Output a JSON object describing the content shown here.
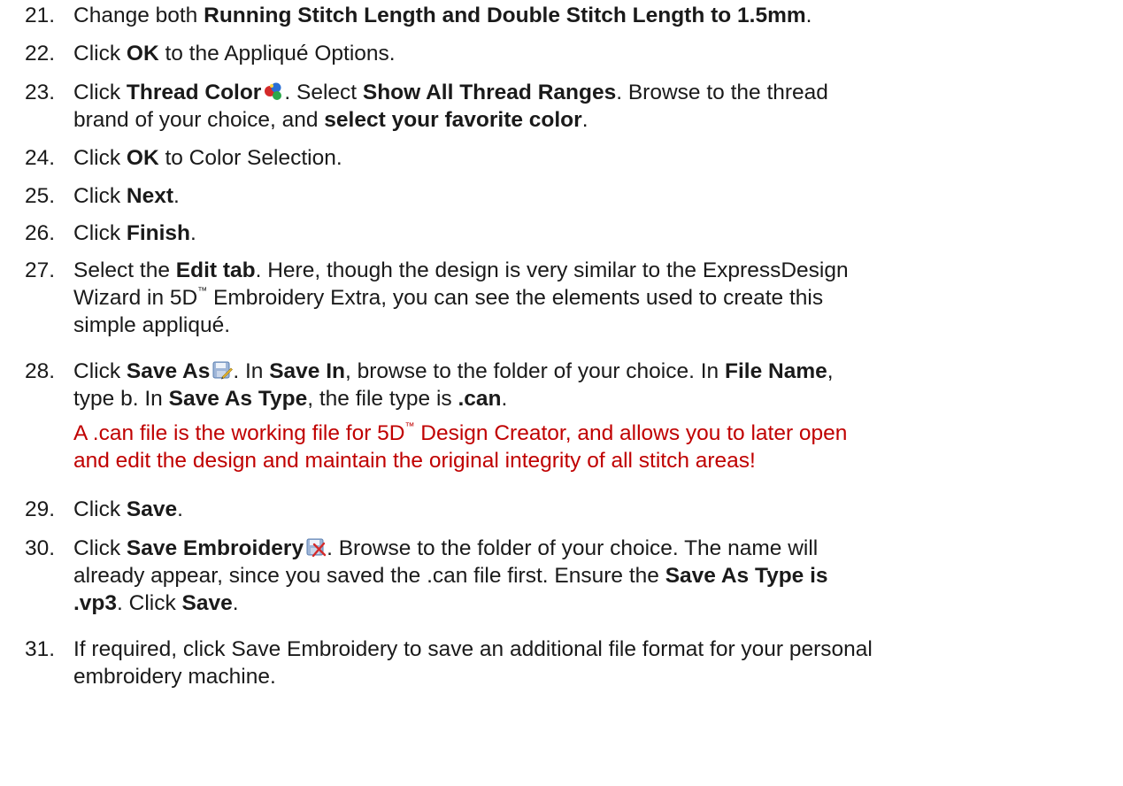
{
  "items": [
    {
      "num": "21.",
      "l1": {
        "a": "Change both ",
        "b": "Running Stitch Length and Double Stitch Length to 1.5mm",
        "c": "."
      }
    },
    {
      "num": "22.",
      "l1": {
        "a": "Click ",
        "b": "OK",
        "c": " to the Appliqué Options."
      }
    },
    {
      "num": "23.",
      "l1": {
        "a": "Click ",
        "b": "Thread Color",
        "c": ".  Select ",
        "d": "Show All Thread Ranges",
        "e": ".  Browse to the thread"
      },
      "l2": {
        "a": "brand of your choice, and ",
        "b": "select your favorite color",
        "c": "."
      }
    },
    {
      "num": "24.",
      "l1": {
        "a": "Click ",
        "b": "OK",
        "c": " to Color Selection."
      }
    },
    {
      "num": "25.",
      "l1": {
        "a": "Click ",
        "b": "Next",
        "c": "."
      }
    },
    {
      "num": "26.",
      "l1": {
        "a": "Click ",
        "b": "Finish",
        "c": "."
      }
    },
    {
      "num": "27.",
      "l1": {
        "a": "Select the ",
        "b": "Edit tab",
        "c": ".  Here, though the design is very similar to the ExpressDesign"
      },
      "l2": {
        "a": "Wizard in 5D",
        "tm": "™",
        "b": " Embroidery Extra, you can see the elements used to create this"
      },
      "l3": "simple appliqué."
    },
    {
      "num": "28.",
      "l1": {
        "a": "Click ",
        "b": "Save As",
        "c": ".  In ",
        "d": "Save In",
        "e": ", browse to the folder of your choice.  In ",
        "f": "File Name",
        "g": ","
      },
      "l2": {
        "a": "type b.  In ",
        "b": "Save As Type",
        "c": ", the file type is ",
        "d": ".can",
        "e": "."
      },
      "note1": {
        "a": "A .can file is the working file for 5D",
        "tm": "™",
        "b": " Design Creator, and allows you to later open"
      },
      "note2": "and edit the design and maintain the original integrity of all stitch areas!"
    },
    {
      "num": "29.",
      "l1": {
        "a": "Click ",
        "b": "Save",
        "c": "."
      }
    },
    {
      "num": "30.",
      "l1": {
        "a": "Click ",
        "b": "Save Embroidery",
        "c": ".  Browse to the folder of your choice.  The name will"
      },
      "l2": "already appear, since you saved the .can file first.  Ensure the ",
      "l2b": "Save As Type is",
      "l3": {
        "b": ".vp3",
        "c": ".  Click ",
        "d": "Save",
        "e": "."
      }
    },
    {
      "num": "31.",
      "l1": "If required, click Save Embroidery to save an additional file format for your personal",
      "l2": "embroidery machine."
    }
  ],
  "colors": {
    "text": "#1a1a1a",
    "note": "#c00000"
  },
  "icons": [
    "thread-color-icon",
    "save-as-icon",
    "save-embroidery-icon"
  ]
}
